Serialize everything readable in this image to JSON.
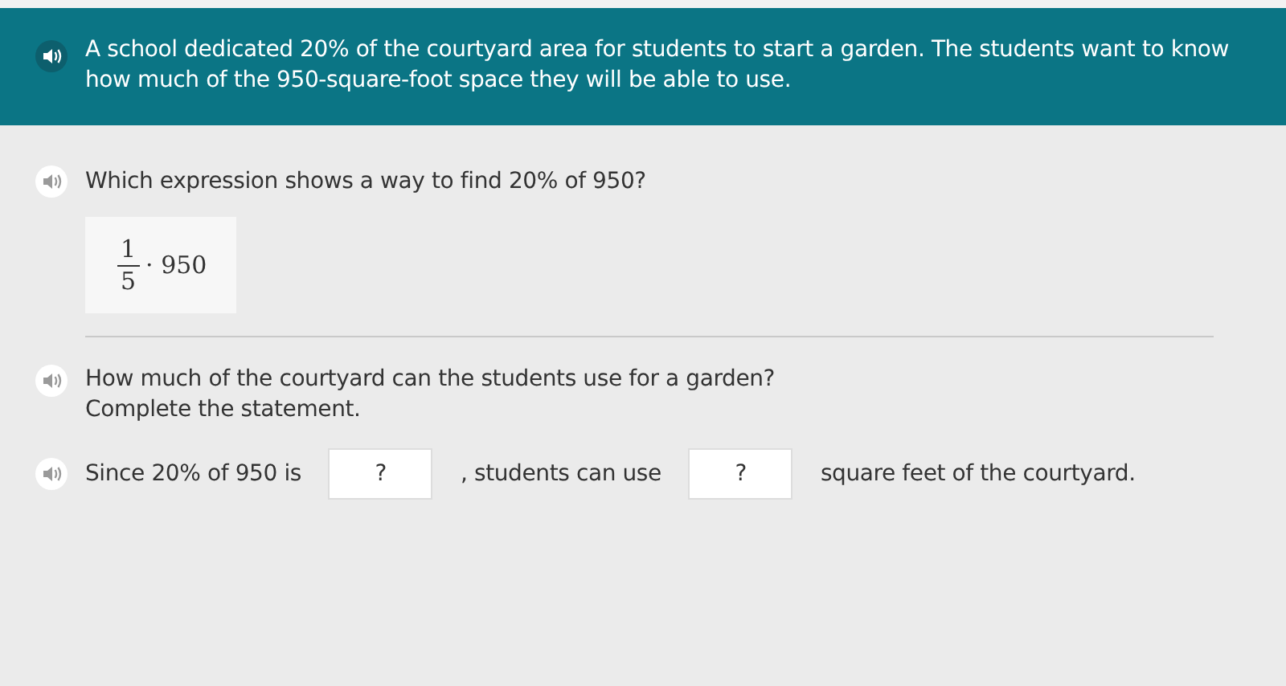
{
  "prompt": {
    "text": "A school dedicated 20% of the courtyard area for students to start a garden. The students want to know how much of the 950-square-foot space they will be able to use."
  },
  "question_1": {
    "text": "Which expression shows a way to find 20% of 950?",
    "expression": {
      "numerator": "1",
      "denominator": "5",
      "rest": "· 950"
    }
  },
  "question_2": {
    "lines": [
      "How much of the courtyard can the students use for a garden?",
      "Complete the statement."
    ],
    "statement": [
      {
        "kind": "text",
        "text": "Since 20% of 950 is"
      },
      {
        "kind": "blank",
        "text": "?"
      },
      {
        "kind": "text",
        "text": ", students can use"
      },
      {
        "kind": "blank",
        "text": "?"
      },
      {
        "kind": "text",
        "text": "square feet of the courtyard."
      }
    ]
  }
}
